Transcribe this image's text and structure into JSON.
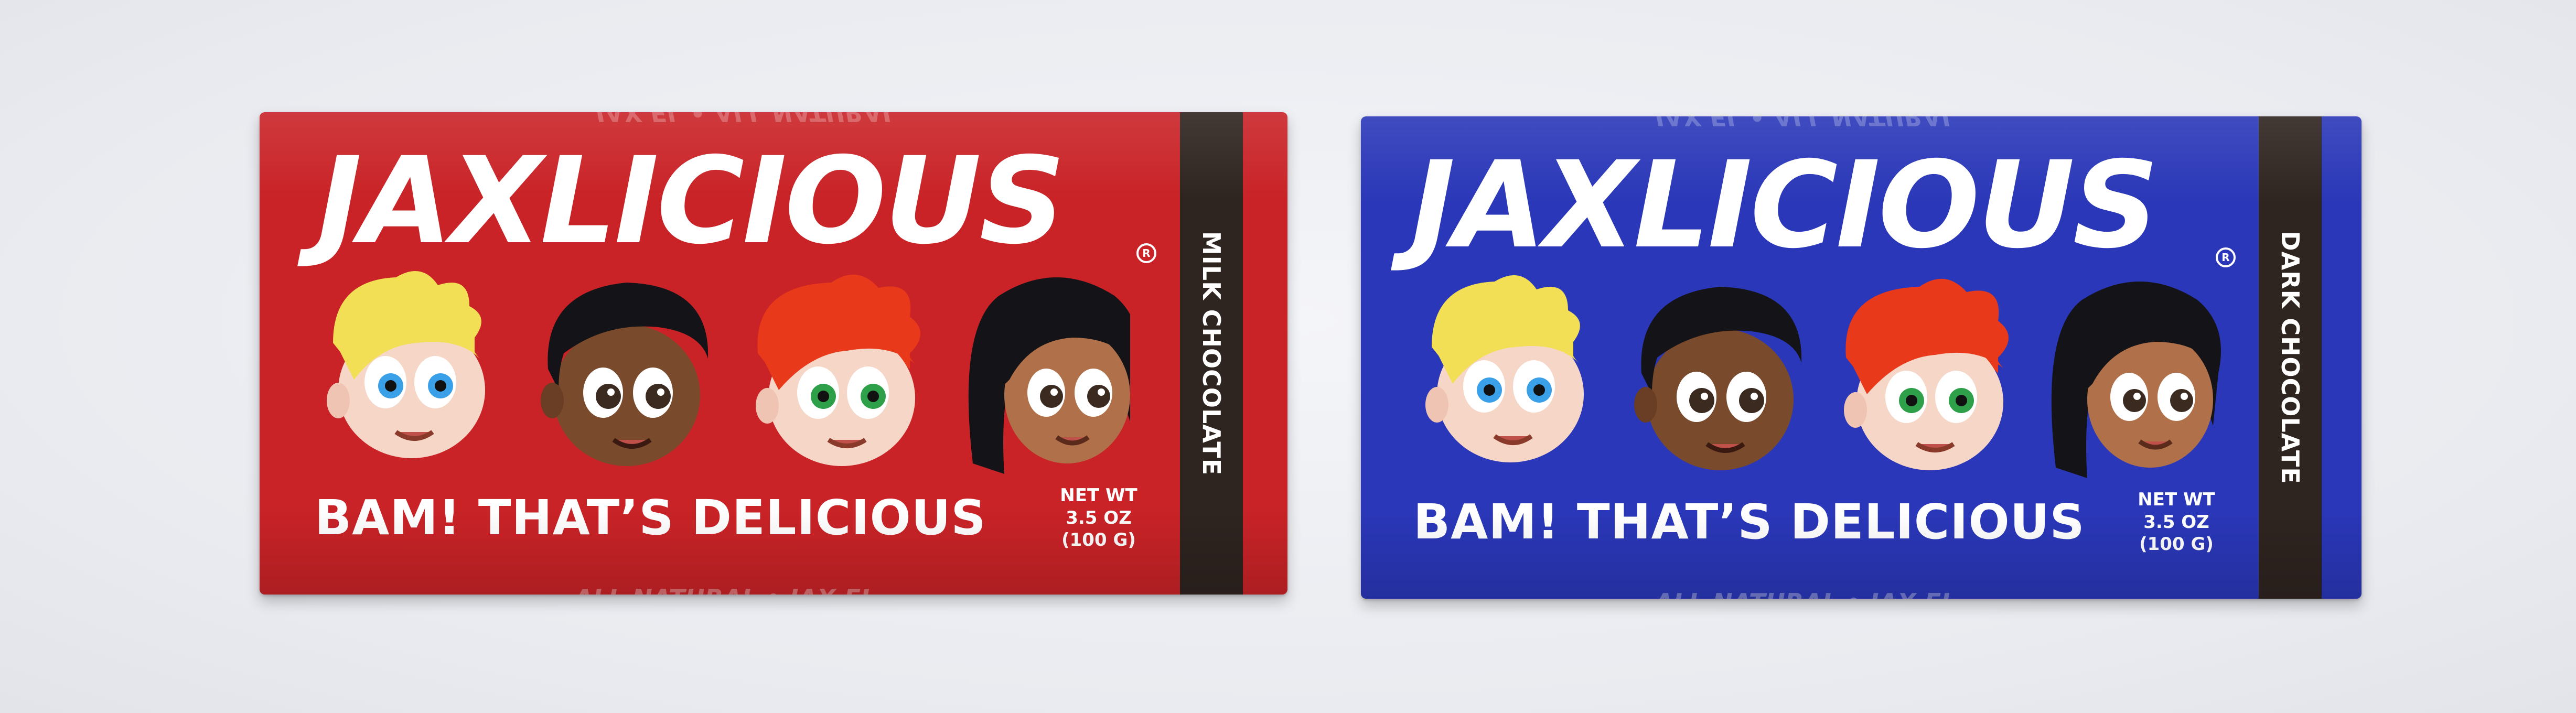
{
  "bars": [
    {
      "brand": "JAXLICIOUS",
      "registered": "R",
      "tagline": "BAM! THAT’S DELICIOUS",
      "net_wt": [
        "NET WT",
        "3.5 OZ",
        "(100 G)"
      ],
      "flavor": "MILK CHOCOLATE",
      "bottom_fold_text": "ALL NATURAL • JAX EL",
      "top_fold_text": "JAX EL • ALL NATURAL",
      "wrapper_color": "#c92327"
    },
    {
      "brand": "JAXLICIOUS",
      "registered": "R",
      "tagline": "BAM! THAT’S DELICIOUS",
      "net_wt": [
        "NET WT",
        "3.5 OZ",
        "(100 G)"
      ],
      "flavor": "DARK CHOCOLATE",
      "bottom_fold_text": "ALL NATURAL • JAX EL",
      "top_fold_text": "JAX EL • ALL NATURAL",
      "wrapper_color": "#2a37b8"
    }
  ],
  "characters": [
    {
      "name": "blond-boy",
      "hair": "#f2df55",
      "skin": "#f6d6c6",
      "eyes": "#3aa0e8"
    },
    {
      "name": "dark-haired-boy",
      "hair": "#141418",
      "skin": "#7a4a2c",
      "eyes": "#3a2a20"
    },
    {
      "name": "redhead-boy",
      "hair": "#e83a1a",
      "skin": "#f6d6c6",
      "eyes": "#2ea04a"
    },
    {
      "name": "dark-haired-girl",
      "hair": "#141418",
      "skin": "#b0704a",
      "eyes": "#3a2a20"
    }
  ]
}
